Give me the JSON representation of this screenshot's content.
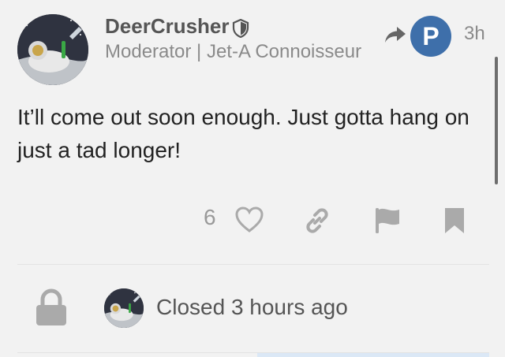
{
  "post": {
    "username": "DeerCrusher",
    "user_title": "Moderator | Jet-A Connoisseur",
    "reply_to_avatar_letter": "P",
    "age": "3h",
    "body": "It’ll come out soon enough. Just gotta hang on just a tad longer!",
    "like_count": "6"
  },
  "small_action": {
    "text": "Closed 3 hours ago"
  },
  "icons": {
    "moderator": "shield-icon",
    "reply": "reply-arrow-icon",
    "like": "heart-icon",
    "link": "link-icon",
    "flag": "flag-icon",
    "bookmark": "bookmark-icon",
    "closed": "lock-icon"
  },
  "colors": {
    "background": "#f2f2f2",
    "reply_avatar": "#3e6faa",
    "muted_text": "#8a8a8a",
    "icon_gray": "#aaaaaa",
    "selection_strip": "#dbe8f6"
  }
}
